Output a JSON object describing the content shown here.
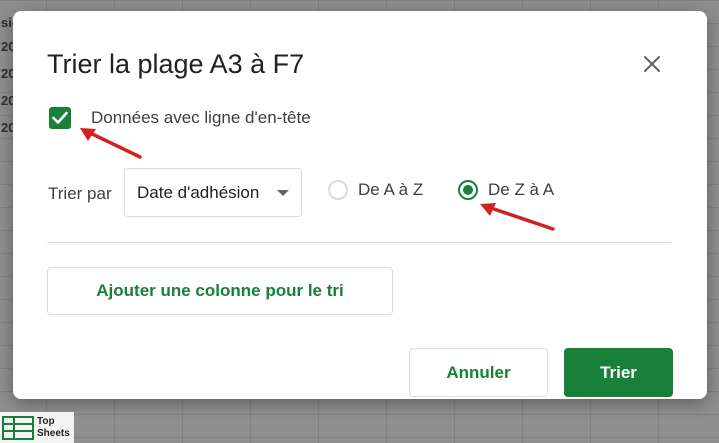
{
  "background_sheet": {
    "cells": [
      "20",
      "20",
      "20",
      "20"
    ],
    "header_cell": "sio"
  },
  "dialog": {
    "title": "Trier la plage A3 à F7",
    "close_icon": "close-icon",
    "header_checkbox": {
      "label": "Données avec ligne d'en-tête",
      "checked": true
    },
    "sort_by": {
      "label": "Trier par",
      "selected_column": "Date d'adhésion"
    },
    "order_options": [
      {
        "label": "De A à Z",
        "selected": false
      },
      {
        "label": "De Z à A",
        "selected": true
      }
    ],
    "add_column_label": "Ajouter une colonne pour le tri",
    "cancel_label": "Annuler",
    "sort_label": "Trier"
  },
  "watermark": {
    "line1": "Top",
    "line2": "Sheets"
  },
  "colors": {
    "accent_green": "#188038",
    "annotation_red": "#d32020"
  }
}
